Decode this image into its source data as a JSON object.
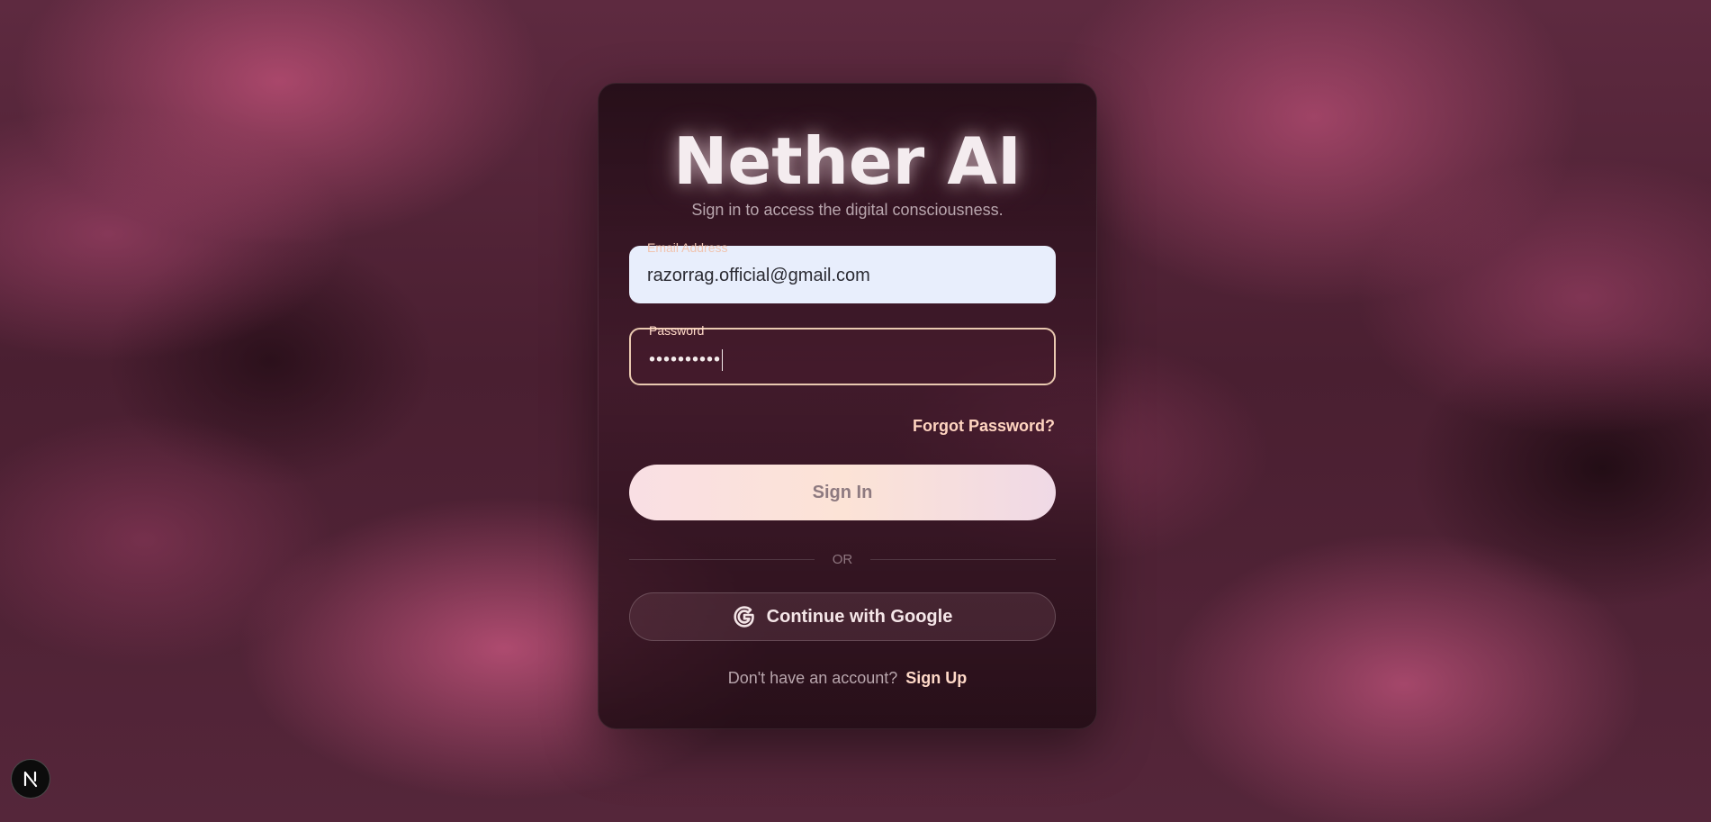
{
  "app": {
    "title": "Nether AI",
    "subtitle": "Sign in to access the digital consciousness."
  },
  "form": {
    "email": {
      "label": "Email Address",
      "value": "razorrag.official@gmail.com"
    },
    "password": {
      "label": "Password",
      "value": "••••••••••"
    },
    "forgot_label": "Forgot Password?",
    "signin_label": "Sign In",
    "divider_label": "OR",
    "google_label": "Continue with Google",
    "signup_prompt": "Don't have an account?",
    "signup_label": "Sign Up"
  },
  "badge": {
    "icon": "nextjs-logo-icon"
  },
  "colors": {
    "accent": "#ffd4c0",
    "button_bg": "#fce3d6",
    "email_field_bg": "#e8eefc",
    "password_border": "#e9c9b0"
  }
}
